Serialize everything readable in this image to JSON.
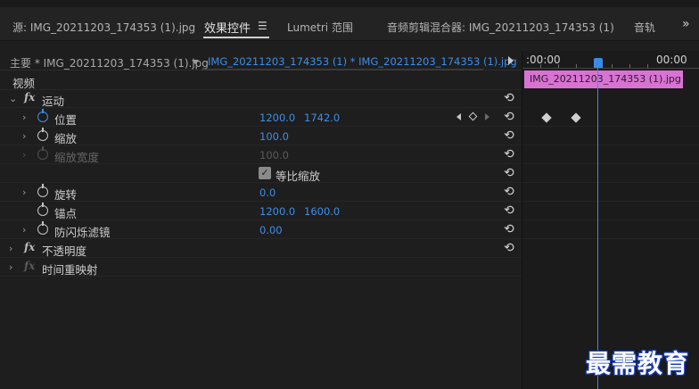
{
  "tabs": [
    {
      "label": "源: IMG_20211203_174353 (1).jpg"
    },
    {
      "label": "效果控件"
    },
    {
      "label": "Lumetri 范围"
    },
    {
      "label": "音频剪辑混合器: IMG_20211203_174353 (1)"
    },
    {
      "label": "音轨"
    }
  ],
  "source": {
    "master": "主要 * IMG_20211203_174353 (1).jpg",
    "clip": "IMG_20211203_174353 (1) * IMG_20211203_174353 (1).jpg"
  },
  "effects": {
    "section": "视频",
    "motion": "运动",
    "position": {
      "label": "位置",
      "x": "1200.0",
      "y": "1742.0"
    },
    "scale": {
      "label": "缩放",
      "value": "100.0"
    },
    "scale_width": {
      "label": "缩放宽度",
      "value": "100.0"
    },
    "uniform_scale": "等比缩放",
    "rotation": {
      "label": "旋转",
      "value": "0.0"
    },
    "anchor": {
      "label": "锚点",
      "x": "1200.0",
      "y": "1600.0"
    },
    "anti_flicker": {
      "label": "防闪烁滤镜",
      "value": "0.00"
    },
    "opacity": "不透明度",
    "time_remap": "时间重映射"
  },
  "timeline": {
    "time_start": ":00:00",
    "time_end": "00:00",
    "clip_name": "IMG_20211203_174353 (1).jpg"
  },
  "watermark": "最需教育",
  "colors": {
    "accent": "#3e8ee8",
    "clip": "#d873d3"
  }
}
